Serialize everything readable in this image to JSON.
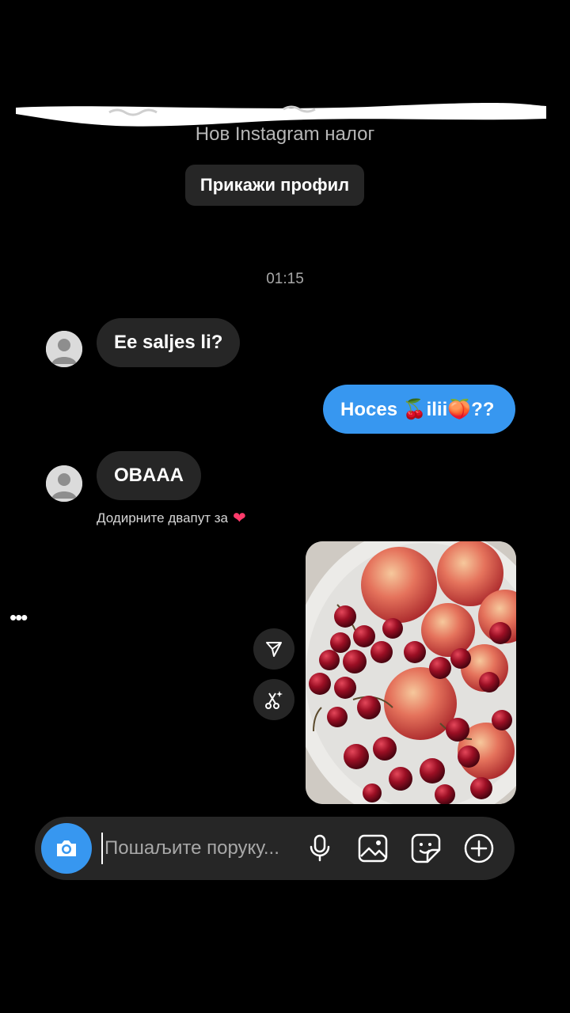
{
  "header": {
    "subtitle": "Нов Instagram налог",
    "view_profile_label": "Прикажи профил"
  },
  "thread": {
    "timestamp": "01:15",
    "messages": [
      {
        "from": "them",
        "text": "Ee saljes li?"
      },
      {
        "from": "me",
        "text": "Hoces 🍒ilii🍑??"
      },
      {
        "from": "them",
        "text": "OBAAA"
      }
    ],
    "double_tap_hint": "Додирните двапут за",
    "heart": "❤"
  },
  "composer": {
    "placeholder": "Пошаљите поруку..."
  },
  "icons": {
    "camera": "camera-icon",
    "mic": "microphone-icon",
    "gallery": "gallery-icon",
    "sticker": "sticker-icon",
    "add": "plus-circle-icon",
    "share": "share-icon",
    "effects": "effects-icon",
    "more": "more-icon"
  },
  "colors": {
    "background": "#000000",
    "bubble_in": "#262626",
    "bubble_out": "#3797f0",
    "accent": "#3797f0"
  }
}
